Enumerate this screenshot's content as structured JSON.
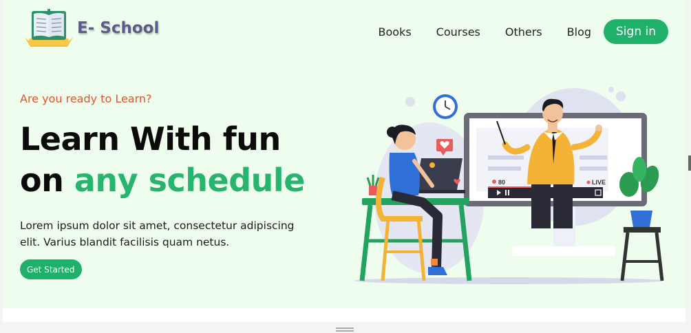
{
  "header": {
    "brand": "E- School",
    "nav": [
      "Books",
      "Courses",
      "Others",
      "Blog"
    ],
    "signin_label": "Sign in"
  },
  "hero": {
    "tagline": "Are you ready to Learn?",
    "headline_line1": "Learn With fun",
    "headline_word_on": "on",
    "headline_highlight": "any schedule",
    "description": "Lorem ipsum dolor sit amet, consectetur adipiscing elit. Varius blandit facilisis quam netus.",
    "cta_label": "Get Started"
  },
  "illustration": {
    "viewer_count": "80",
    "live_label": "LIVE"
  },
  "colors": {
    "background": "#effdef",
    "accent_green": "#1fb169",
    "tagline_orange": "#e2542c"
  }
}
